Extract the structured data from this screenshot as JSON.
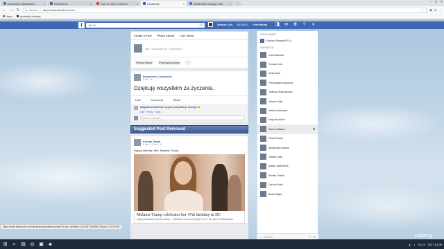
{
  "browser": {
    "tabs": [
      {
        "label": "Developer Dashboard",
        "color": "#4a7bd0",
        "active": false
      },
      {
        "label": "Extensions",
        "color": "#5b6b7d",
        "active": false
      },
      {
        "label": "How to host a chrome",
        "color": "#cc4444",
        "active": false
      },
      {
        "label": "Facebook",
        "color": "#3b5998",
        "active": true
      },
      {
        "label": "Install and manage exte",
        "color": "#4a7bd0",
        "active": false
      }
    ],
    "close_glyph": "×",
    "secure_label": "Secure",
    "url": "https://www.facebook.com",
    "bookmarks": [
      {
        "label": "Apps"
      },
      {
        "label": "godaddy hosting"
      }
    ],
    "status_url": "https://www.facebook.com/ufi/reaction/profile/browser/?ft_ent_identifier=1013287135688735&av=100709769"
  },
  "facebook": {
    "logo": "f",
    "search_text": "1l9l l4t",
    "search_icon": "search-icon",
    "user_name": "Szaszu Crik",
    "nav_items": [
      "127.0.0.1",
      "Find+Mhhs"
    ],
    "composer": {
      "tabs": [
        "Create a Post",
        "Photo Album",
        "Live Video"
      ],
      "placeholder": "albl7 hbcqqhf0 jbil. Pdzblcligz?",
      "actions": [
        "Photo/Video",
        "Feeling/Activity",
        "···"
      ]
    },
    "post1": {
      "author": "Bogumiusz Lytkowski",
      "meta": "8 hrs · ⚙",
      "text": "Dziękuję wszystkim za życzenia.",
      "actions": [
        "Like",
        "Comment",
        "Share"
      ],
      "comment_author": "Magdalena Muchula",
      "comment_text": "Życzymy wszystkiego dobrego 😊",
      "comment_links": "Like · Reply · 3 hrs",
      "write_placeholder": "Write a comment..."
    },
    "suggested_removed": "Suggested Post Removed",
    "post2": {
      "author": "Kishan Dayal",
      "meta": "8 hrs · 13 hrs · ⚙",
      "text": "Happy birthday, Mrs. Melania Trump",
      "link_title": "Melania Trump celebrates her 47th birthday in DC",
      "link_desc": "Happy birthday to the first lady — Melania Trump is ringing in her 47th year in Washington."
    }
  },
  "sidebar": {
    "pages_header": "YOUR PAGES",
    "page_name": "Komisz Okupacji PIS-u",
    "contacts_header": "CONTACTS",
    "contacts": [
      {
        "name": "John Barkacki",
        "status": "",
        "online": false
      },
      {
        "name": "Tomasz Knia",
        "status": "",
        "online": false
      },
      {
        "name": "Anda Anda",
        "status": "",
        "online": false
      },
      {
        "name": "Przemysław Kaliszcow",
        "status": "",
        "online": false
      },
      {
        "name": "Tadeusz Rutkowszcko",
        "status": "",
        "online": false
      },
      {
        "name": "Joanna Kiste",
        "status": "",
        "online": false
      },
      {
        "name": "Marlena Wronska",
        "status": "",
        "online": false
      },
      {
        "name": "Maja Mucedina",
        "status": "",
        "online": false
      },
      {
        "name": "Marcus Walcze",
        "status": "",
        "online": true
      },
      {
        "name": "Pawel Placon",
        "status": "",
        "online": false
      },
      {
        "name": "Aleksandra Janska",
        "status": "",
        "online": false
      },
      {
        "name": "Jolanta Lady",
        "status": "",
        "online": false
      },
      {
        "name": "Maciej Jastrzesmk",
        "status": "",
        "online": false
      },
      {
        "name": "Renata Osinek",
        "status": "",
        "online": false
      },
      {
        "name": "Dariusz Knell",
        "status": "",
        "online": false
      },
      {
        "name": "Beata Sajda",
        "status": "",
        "online": false
      }
    ],
    "search_placeholder": "Search"
  },
  "taskbar": {
    "time": "02:14",
    "date": "2017-04-26"
  },
  "watermark": "udemy"
}
